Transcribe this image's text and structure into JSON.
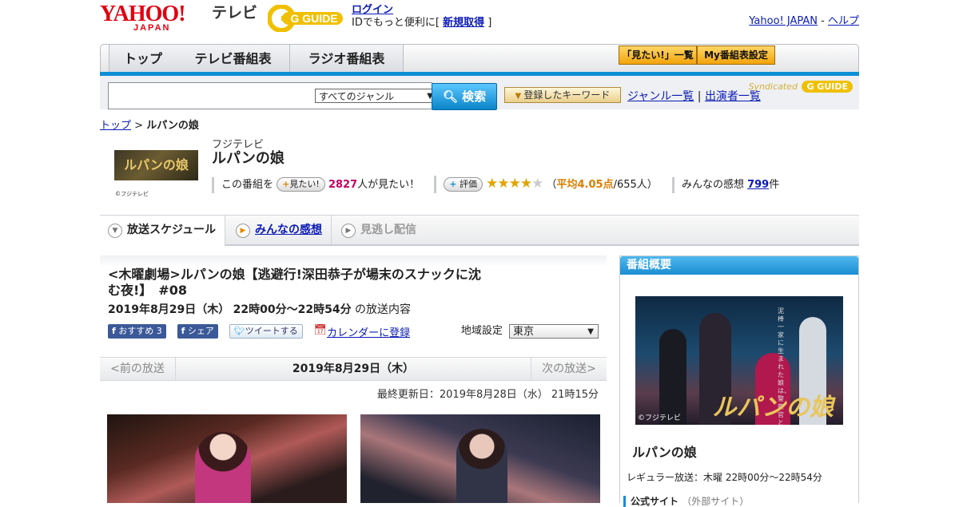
{
  "header": {
    "logo_text": "YAHOO!",
    "logo_sub": "JAPAN",
    "service": "テレビ",
    "gguide_logo": "G GUIDE",
    "login": "ログイン",
    "id_text": "IDでもっと便利に[",
    "signup": "新規取得",
    "id_close": "]",
    "yahoo_japan": "Yahoo! JAPAN",
    "sep": " - ",
    "help": "ヘルプ"
  },
  "nav": {
    "tabs": [
      "トップ",
      "テレビ番組表",
      "ラジオ番組表"
    ],
    "want_list": "「見たい!」一覧",
    "my_schedule": "My番組表設定"
  },
  "search": {
    "genre": "すべてのジャンル",
    "button": "検索",
    "keyword_button": "登録したキーワード",
    "genre_list": "ジャンル一覧",
    "divider": "|",
    "cast_list": "出演者一覧",
    "syndicated": "Syndicated"
  },
  "breadcrumb": {
    "top": "トップ",
    "sep": " > ",
    "current": "ルパンの娘"
  },
  "program": {
    "thumb_text": "ルパンの娘",
    "thumb_credit": "©フジテレビ",
    "station": "フジテレビ",
    "title": "ルパンの娘",
    "want_prefix": "この番組を",
    "want_button": "見たい!",
    "want_count": "2827",
    "want_suffix": "人が見たい！",
    "rate_button": "評価",
    "stars_on": "★★★★",
    "stars_off": "★",
    "avg_open": "（",
    "avg_score": "平均4.05点",
    "avg_count": "/655人）",
    "impressions_label": "みんなの感想",
    "impressions_count": "799",
    "impressions_unit": "件"
  },
  "tabs": {
    "schedule": "放送スケジュール",
    "impressions": "みんなの感想",
    "catchup": "見逃し配信"
  },
  "episode": {
    "title": "<木曜劇場>ルパンの娘【逃避行!深田恭子が場末のスナックに沈む夜!】　#08",
    "date": "2019年8月29日（木）",
    "time": "22時00分～22時54分",
    "date_suffix": "の放送内容",
    "fb_recommend": "おすすめ",
    "fb_count": "3",
    "fb_share": "シェア",
    "tweet": "ツイートする",
    "calendar": "カレンダーに登録",
    "region_label": "地域設定",
    "region_value": "東京"
  },
  "pager": {
    "prev": "<前の放送",
    "current": "2019年8月29日（木）",
    "next": "次の放送>"
  },
  "updated": "最終更新日：2019年8月28日（水） 21時15分",
  "sidebar": {
    "heading": "番組概要",
    "poster_title": "ルパンの娘",
    "poster_credit": "©フジテレビ",
    "poster_tagline": "泥棒一家に生まれた娘は、警察官と恋に落ちる",
    "title": "ルパンの娘",
    "regular": "レギュラー放送：木曜 22時00分～22時54分",
    "official_label": "公式サイト",
    "official_note": "（外部サイト）"
  }
}
